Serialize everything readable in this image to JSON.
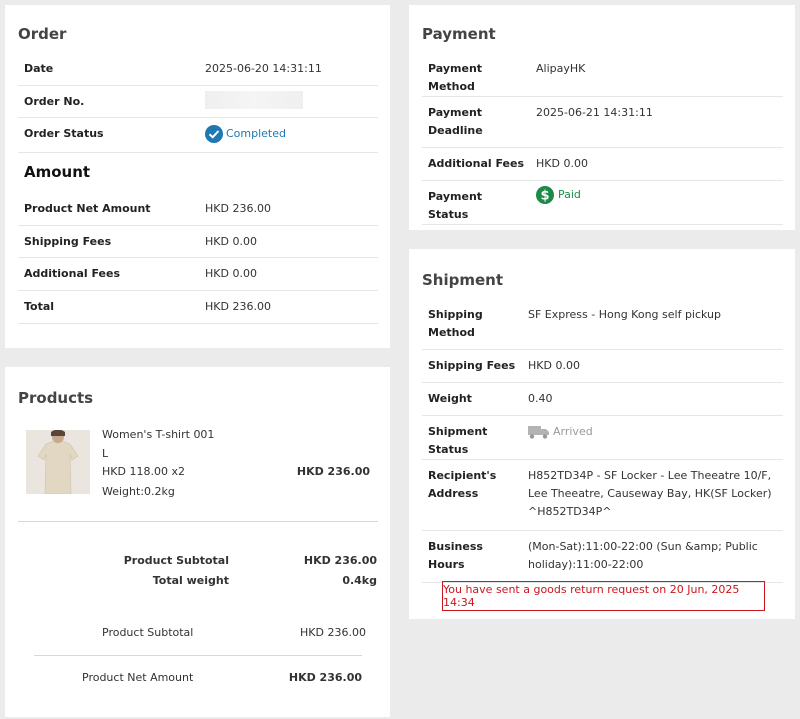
{
  "order": {
    "title": "Order",
    "rows": [
      {
        "label": "Date",
        "value": "2025-06-20 14:31:11"
      },
      {
        "label": "Order No.",
        "value": ""
      },
      {
        "label": "Order Status",
        "value": "Completed"
      }
    ],
    "amount_title": "Amount",
    "amount_rows": [
      {
        "label": "Product Net Amount",
        "value": "HKD 236.00"
      },
      {
        "label": "Shipping Fees",
        "value": "HKD 0.00"
      },
      {
        "label": "Additional Fees",
        "value": "HKD 0.00"
      },
      {
        "label": "Total",
        "value": "HKD 236.00"
      }
    ]
  },
  "products": {
    "title": "Products",
    "item": {
      "name": "Women's T-shirt 001",
      "size": "L",
      "price_qty": "HKD 118.00 x2",
      "weight": "Weight:0.2kg",
      "line_total": "HKD 236.00"
    },
    "summary": [
      {
        "label": "Product Subtotal",
        "value": "HKD 236.00"
      },
      {
        "label": "Total weight",
        "value": "0.4kg"
      }
    ],
    "totals": [
      {
        "label": "Product Subtotal",
        "value": "HKD 236.00"
      },
      {
        "label": "Product Net Amount",
        "value": "HKD 236.00"
      }
    ]
  },
  "payment": {
    "title": "Payment",
    "rows": [
      {
        "label": "Payment Method",
        "value": "AlipayHK"
      },
      {
        "label": "Payment Deadline",
        "value": "2025-06-21 14:31:11"
      },
      {
        "label": "Additional Fees",
        "value": "HKD 0.00"
      },
      {
        "label": "Payment Status",
        "value": "Paid"
      }
    ]
  },
  "shipment": {
    "title": "Shipment",
    "rows": [
      {
        "label": "Shipping Method",
        "value": "SF Express - Hong Kong self pickup"
      },
      {
        "label": "Shipping Fees",
        "value": "HKD 0.00"
      },
      {
        "label": "Weight",
        "value": "0.40"
      },
      {
        "label": "Shipment Status",
        "value": "Arrived"
      },
      {
        "label": "Recipient's Address",
        "value": "H852TD34P - SF Locker - Lee Theeatre 10/F, Lee Theeatre, Causeway Bay, HK(SF Locker) ^H852TD34P^"
      },
      {
        "label": "Business Hours",
        "value": "(Mon-Sat):11:00-22:00 (Sun &amp; Public holiday):11:00-22:00"
      }
    ],
    "notice": "You have sent a goods return request on 20 Jun, 2025 14:34"
  },
  "colors": {
    "completed": "#1f78b4",
    "paid": "#1d8a4a",
    "alert": "#c9171d"
  }
}
